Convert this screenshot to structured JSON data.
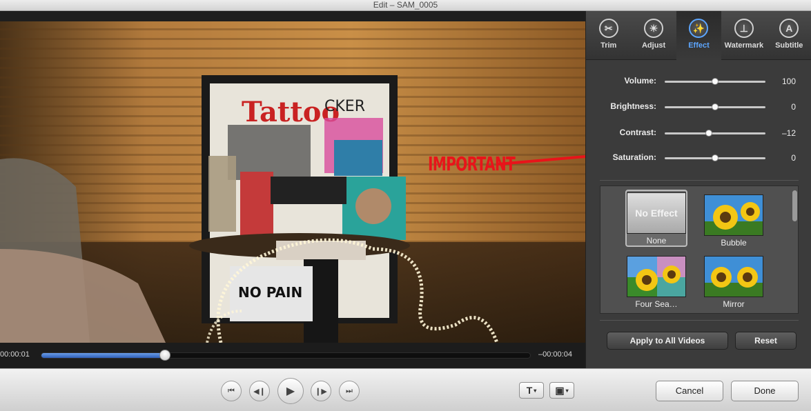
{
  "window": {
    "title": "Edit – SAM_0005"
  },
  "annotation": {
    "text": "IMPORTANT",
    "color": "#e8141a"
  },
  "video": {
    "time_elapsed": "00:00:01",
    "time_remaining": "–00:00:04",
    "progress_fraction": 0.253
  },
  "tabs": [
    {
      "label": "Trim",
      "icon": "scissors-icon",
      "glyph": "✂",
      "active": false
    },
    {
      "label": "Adjust",
      "icon": "sun-icon",
      "glyph": "☀",
      "active": false
    },
    {
      "label": "Effect",
      "icon": "magic-wand-icon",
      "glyph": "✨",
      "active": true
    },
    {
      "label": "Watermark",
      "icon": "stamp-icon",
      "glyph": "⊥",
      "active": false
    },
    {
      "label": "Subtitle",
      "icon": "letter-a-icon",
      "glyph": "A",
      "active": false
    }
  ],
  "adjustments": [
    {
      "label": "Volume:",
      "value": "100",
      "position": 0.5
    },
    {
      "label": "Brightness:",
      "value": "0",
      "position": 0.5
    },
    {
      "label": "Contrast:",
      "value": "–12",
      "position": 0.44
    },
    {
      "label": "Saturation:",
      "value": "0",
      "position": 0.5
    }
  ],
  "effects": {
    "none_thumb_text": "No Effect",
    "items": [
      {
        "label": "None",
        "selected": true
      },
      {
        "label": "Bubble",
        "selected": false
      },
      {
        "label": "Four Sea…",
        "selected": false
      },
      {
        "label": "Mirror",
        "selected": false
      }
    ]
  },
  "panel_buttons": {
    "apply_all": "Apply to All Videos",
    "reset": "Reset"
  },
  "controls": {
    "text_tool_glyph": "T",
    "camera_glyph": "▣",
    "cancel": "Cancel",
    "done": "Done"
  },
  "colors": {
    "accent": "#5da6ff",
    "progress": "#3a6fc8"
  }
}
